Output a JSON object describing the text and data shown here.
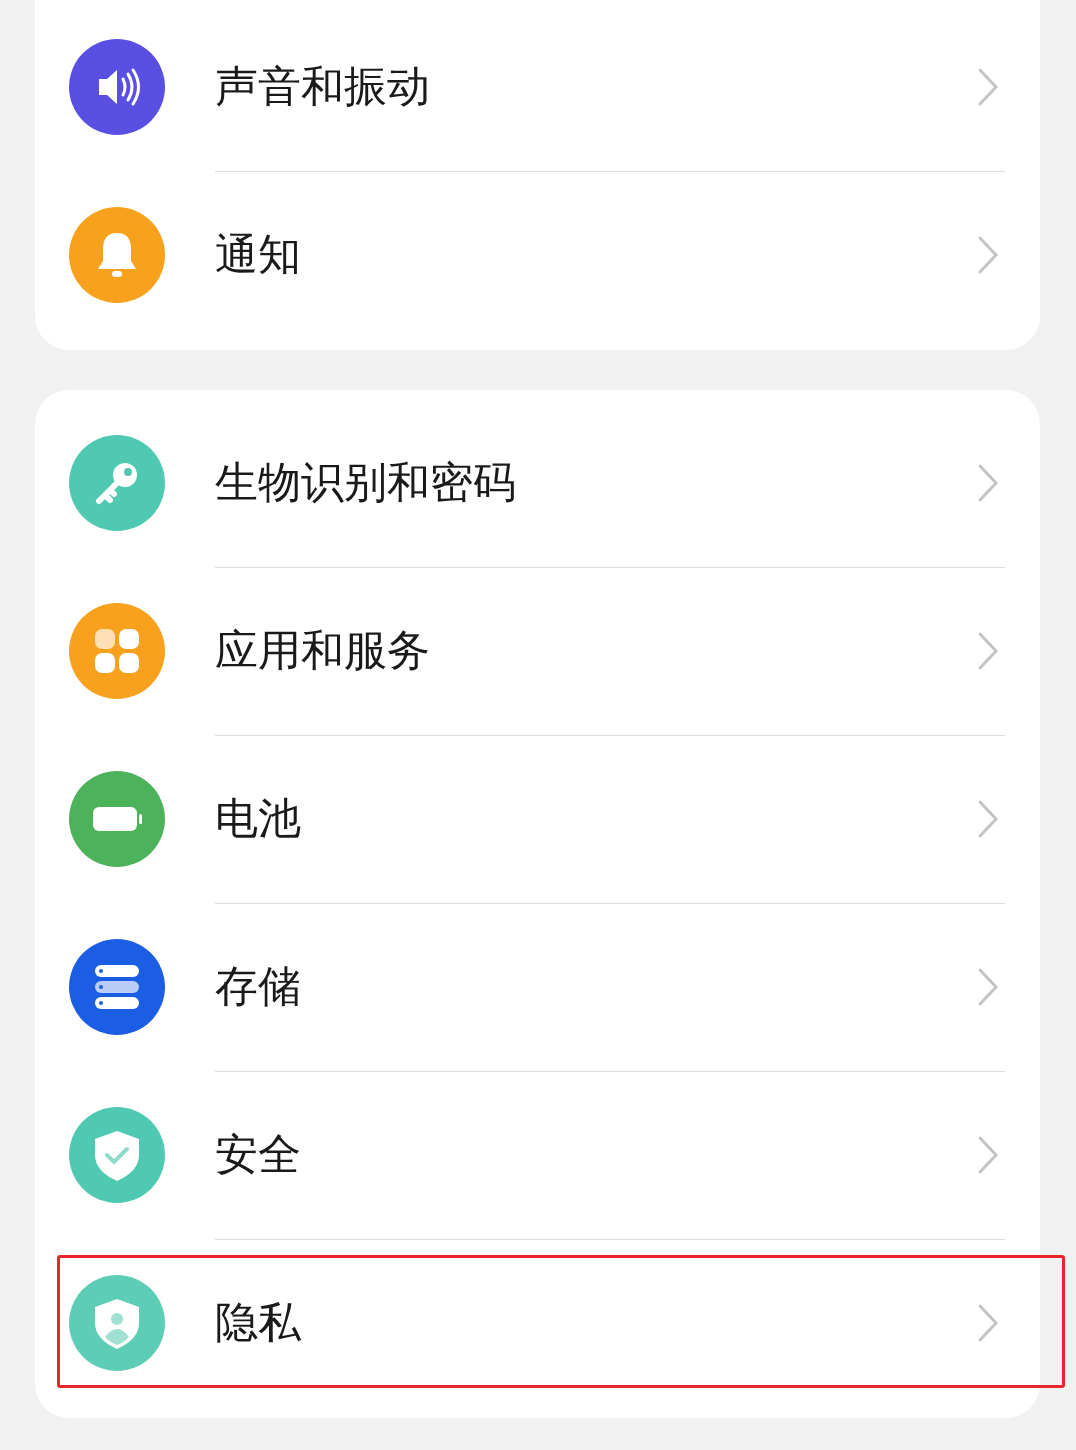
{
  "groups": [
    {
      "items": [
        {
          "kind": "sound",
          "label": "声音和振动",
          "highlighted": false
        },
        {
          "kind": "bell",
          "label": "通知",
          "highlighted": false
        }
      ]
    },
    {
      "items": [
        {
          "kind": "key",
          "label": "生物识别和密码",
          "highlighted": false
        },
        {
          "kind": "apps",
          "label": "应用和服务",
          "highlighted": false
        },
        {
          "kind": "battery",
          "label": "电池",
          "highlighted": false
        },
        {
          "kind": "storage",
          "label": "存储",
          "highlighted": false
        },
        {
          "kind": "shield",
          "label": "安全",
          "highlighted": false
        },
        {
          "kind": "privacy",
          "label": "隐私",
          "highlighted": true
        }
      ]
    }
  ]
}
